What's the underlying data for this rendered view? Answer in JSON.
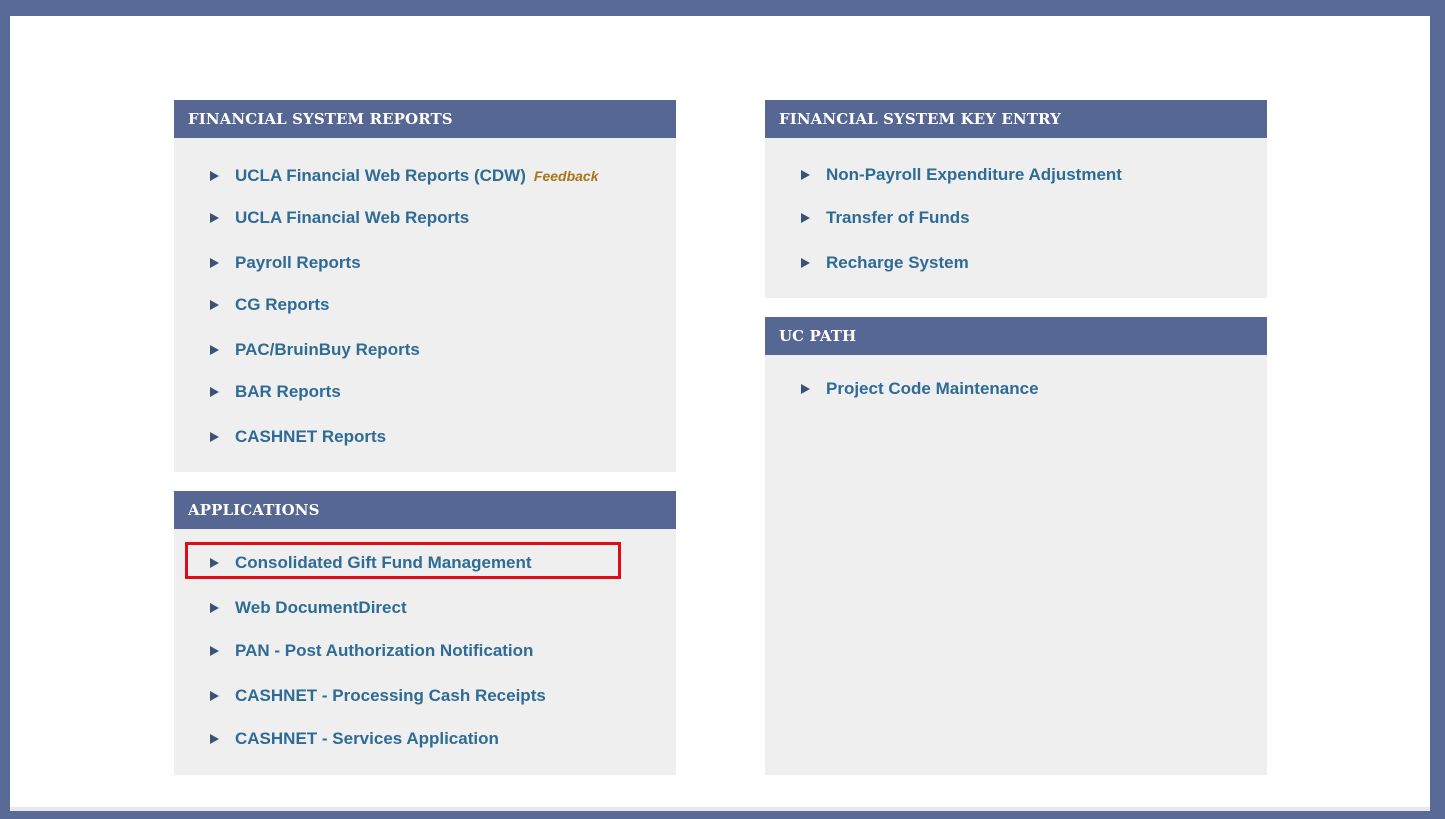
{
  "panels": {
    "reports": {
      "title": "FINANCIAL SYSTEM REPORTS",
      "items": [
        {
          "label": "UCLA Financial Web Reports (CDW)",
          "extra": "Feedback"
        },
        {
          "label": "UCLA Financial Web Reports"
        },
        {
          "label": "Payroll Reports"
        },
        {
          "label": "CG Reports"
        },
        {
          "label": "PAC/BruinBuy Reports"
        },
        {
          "label": "BAR Reports"
        },
        {
          "label": "CASHNET Reports"
        }
      ]
    },
    "applications": {
      "title": "APPLICATIONS",
      "items": [
        {
          "label": "Consolidated Gift Fund Management"
        },
        {
          "label": "Web DocumentDirect"
        },
        {
          "label": "PAN - Post Authorization Notification"
        },
        {
          "label": "CASHNET - Processing Cash Receipts"
        },
        {
          "label": "CASHNET - Services Application"
        }
      ]
    },
    "key_entry": {
      "title": "FINANCIAL SYSTEM KEY ENTRY",
      "items": [
        {
          "label": "Non-Payroll Expenditure Adjustment"
        },
        {
          "label": "Transfer of Funds"
        },
        {
          "label": "Recharge System"
        }
      ]
    },
    "uc_path": {
      "title": "UC PATH",
      "items": [
        {
          "label": "Project Code Maintenance"
        }
      ]
    }
  },
  "colors": {
    "header_bg": "#576793",
    "link": "#2e6b95",
    "feedback": "#a8751d",
    "highlight": "#e10a17"
  }
}
